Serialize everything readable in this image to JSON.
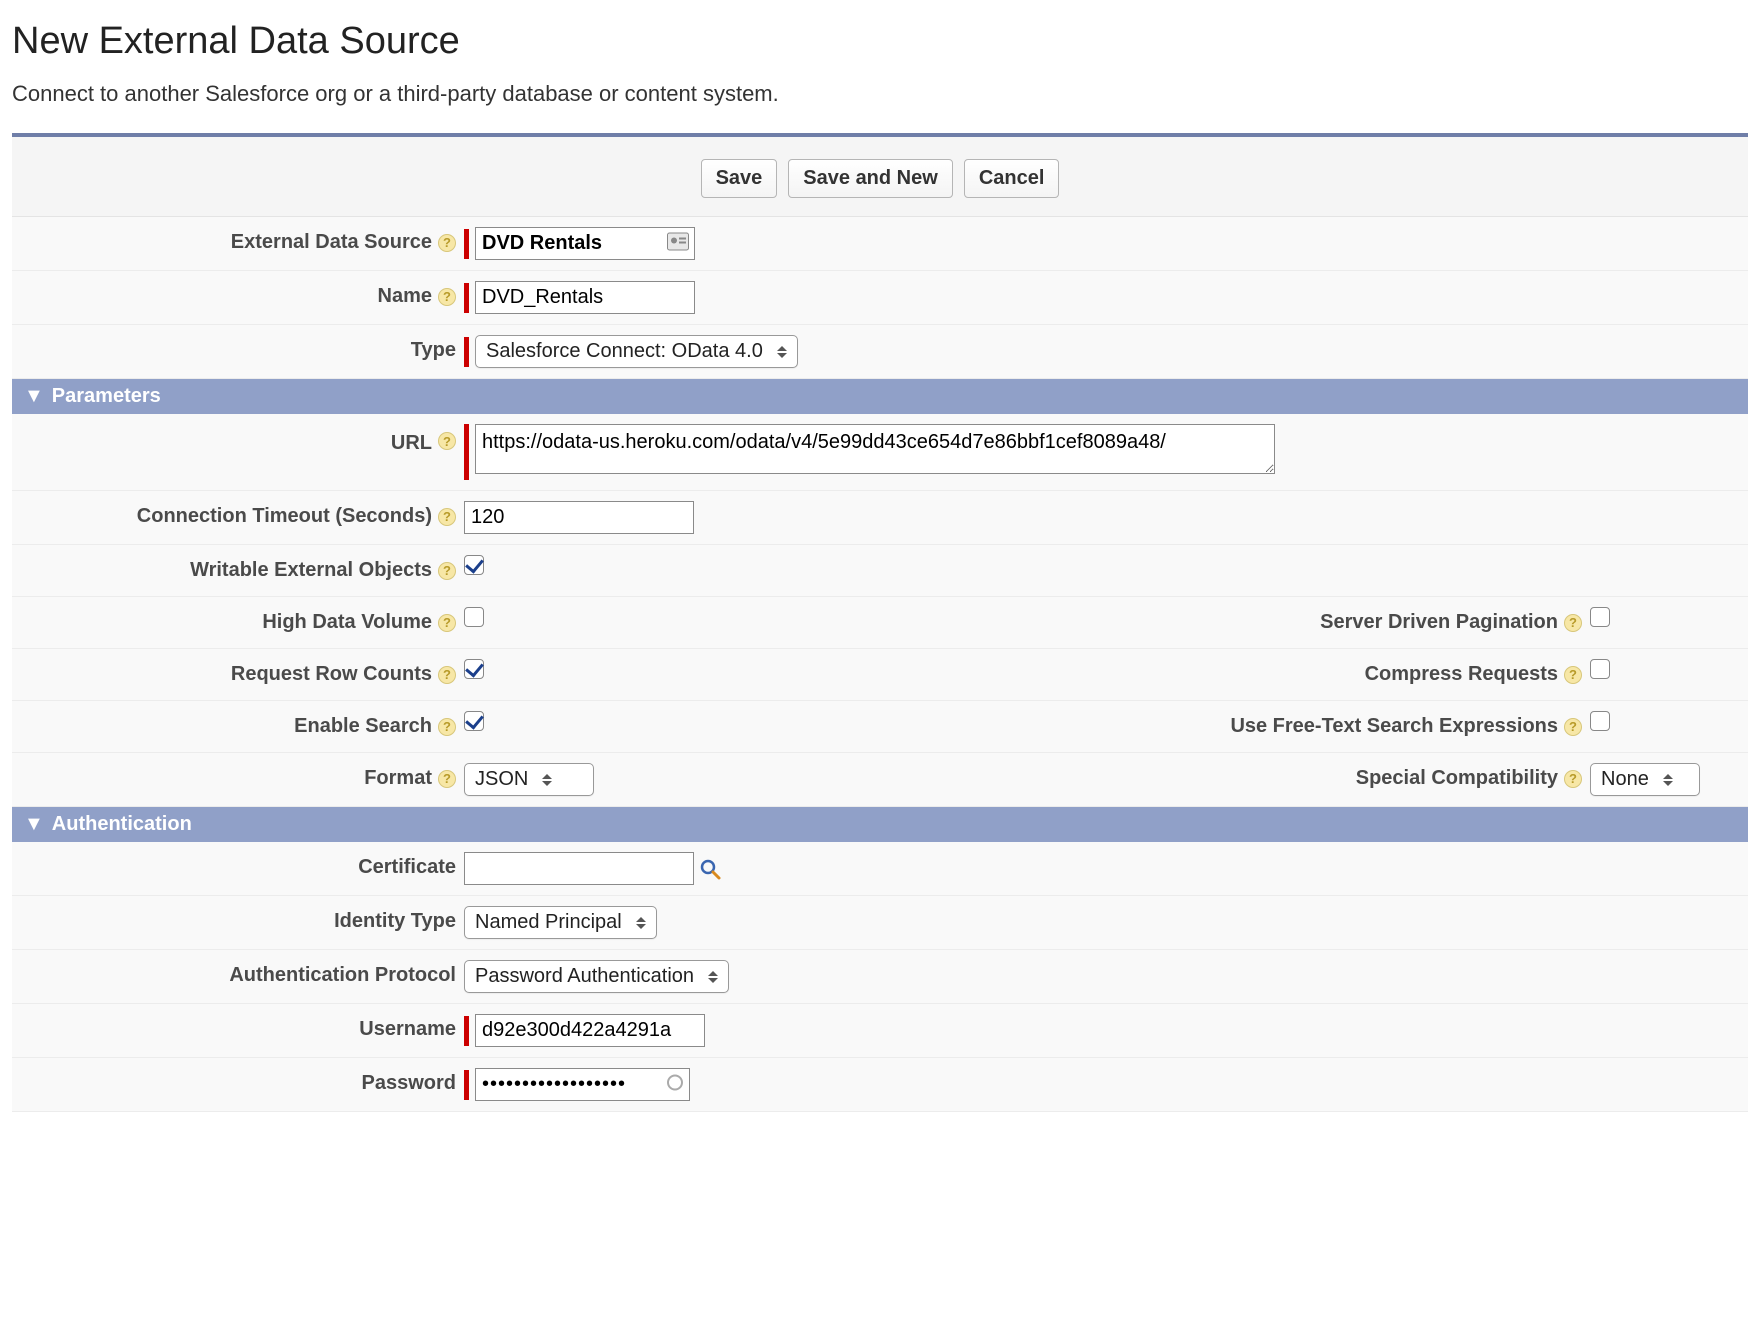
{
  "page": {
    "title": "New External Data Source",
    "description": "Connect to another Salesforce org or a third-party database or content system."
  },
  "buttons": {
    "save": "Save",
    "save_new": "Save and New",
    "cancel": "Cancel"
  },
  "labels": {
    "external_data_source": "External Data Source",
    "name": "Name",
    "type": "Type",
    "parameters": "Parameters",
    "url": "URL",
    "connection_timeout": "Connection Timeout (Seconds)",
    "writable_external_objects": "Writable External Objects",
    "high_data_volume": "High Data Volume",
    "server_driven_pagination": "Server Driven Pagination",
    "request_row_counts": "Request Row Counts",
    "compress_requests": "Compress Requests",
    "enable_search": "Enable Search",
    "free_text_search": "Use Free-Text Search Expressions",
    "format": "Format",
    "special_compatibility": "Special Compatibility",
    "authentication": "Authentication",
    "certificate": "Certificate",
    "identity_type": "Identity Type",
    "auth_protocol": "Authentication Protocol",
    "username": "Username",
    "password": "Password"
  },
  "values": {
    "external_data_source": "DVD Rentals",
    "name": "DVD_Rentals",
    "type": "Salesforce Connect: OData 4.0",
    "url": "https://odata-us.heroku.com/odata/v4/5e99dd43ce654d7e86bbf1cef8089a48/",
    "connection_timeout": "120",
    "writable_external_objects": true,
    "high_data_volume": false,
    "server_driven_pagination": false,
    "request_row_counts": true,
    "compress_requests": false,
    "enable_search": true,
    "free_text_search": false,
    "format": "JSON",
    "special_compatibility": "None",
    "certificate": "",
    "identity_type": "Named Principal",
    "auth_protocol": "Password Authentication",
    "username": "d92e300d422a4291a",
    "password": "••••••••••••••••••"
  }
}
